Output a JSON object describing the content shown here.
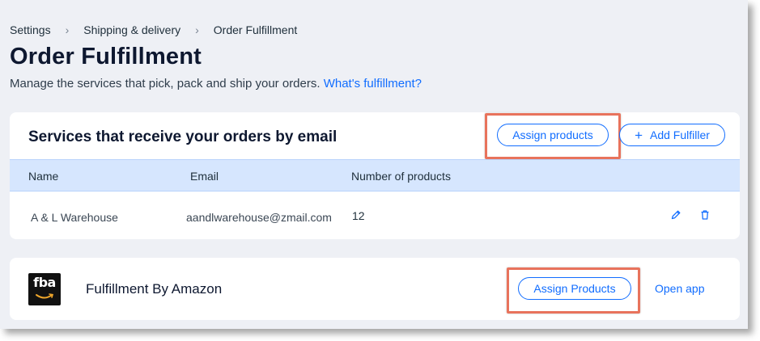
{
  "breadcrumb": {
    "items": [
      "Settings",
      "Shipping & delivery",
      "Order Fulfillment"
    ],
    "separator": "›"
  },
  "page": {
    "title": "Order Fulfillment",
    "subtitle": "Manage the services that pick, pack and ship your orders.",
    "help_link": "What's fulfillment?"
  },
  "email_services": {
    "heading": "Services that receive your orders by email",
    "assign_button": "Assign products",
    "add_button": "Add Fulfiller",
    "add_icon": "+",
    "columns": [
      "Name",
      "Email",
      "Number of products"
    ],
    "rows": [
      {
        "name": "A & L Warehouse",
        "email": "aandlwarehouse@zmail.com",
        "count": "12"
      }
    ]
  },
  "fba": {
    "logo_text": "fba",
    "name": "Fulfillment By Amazon",
    "assign_button": "Assign Products",
    "open_app": "Open app"
  },
  "colors": {
    "accent": "#116dff",
    "highlight": "#e8735c",
    "table_header": "#d6e6fe",
    "background": "#eef0f5"
  }
}
